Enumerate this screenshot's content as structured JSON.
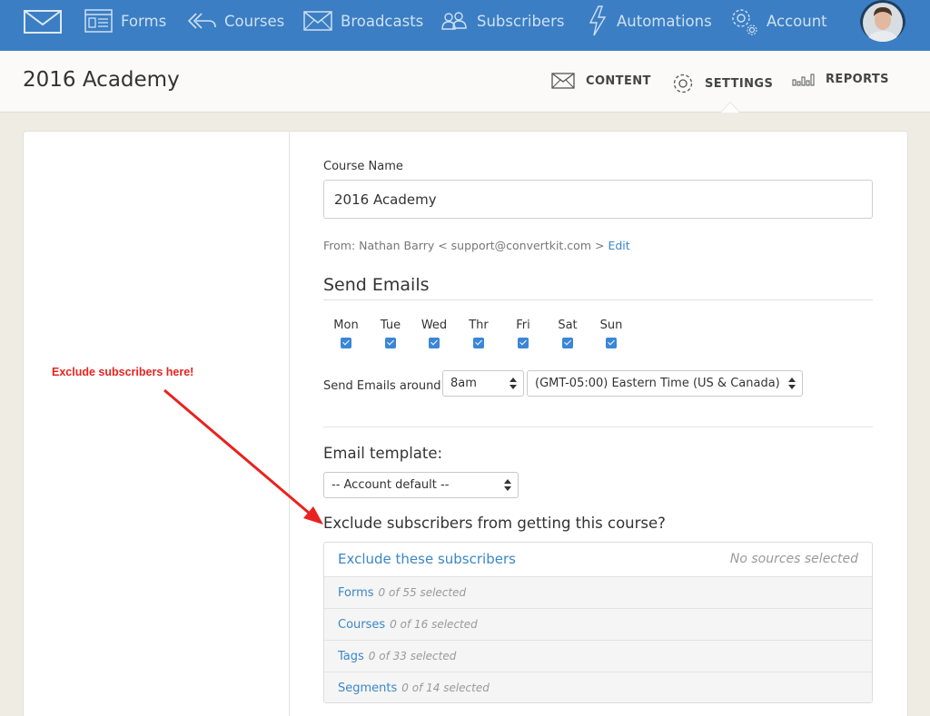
{
  "nav": {
    "items": [
      {
        "label": "Forms",
        "icon": "forms-icon"
      },
      {
        "label": "Courses",
        "icon": "courses-icon"
      },
      {
        "label": "Broadcasts",
        "icon": "broadcasts-icon"
      },
      {
        "label": "Subscribers",
        "icon": "subscribers-icon"
      },
      {
        "label": "Automations",
        "icon": "automations-icon"
      },
      {
        "label": "Account",
        "icon": "account-icon"
      }
    ]
  },
  "header": {
    "title": "2016 Academy",
    "tabs": [
      {
        "label": "CONTENT",
        "icon": "envelope-icon"
      },
      {
        "label": "SETTINGS",
        "icon": "gear-icon"
      },
      {
        "label": "REPORTS",
        "icon": "bar-chart-icon"
      }
    ]
  },
  "form": {
    "course_name_label": "Course Name",
    "course_name_value": "2016 Academy",
    "from_text": "From: Nathan Barry < support@convertkit.com >",
    "edit_link": "Edit",
    "send_emails_heading": "Send Emails",
    "days": [
      {
        "label": "Mon",
        "checked": true
      },
      {
        "label": "Tue",
        "checked": true
      },
      {
        "label": "Wed",
        "checked": true
      },
      {
        "label": "Thr",
        "checked": true
      },
      {
        "label": "Fri",
        "checked": true
      },
      {
        "label": "Sat",
        "checked": true
      },
      {
        "label": "Sun",
        "checked": true
      }
    ],
    "send_around_label": "Send Emails around",
    "time_value": "8am",
    "timezone_value": "(GMT-05:00) Eastern Time (US & Canada)",
    "template_heading": "Email template:",
    "template_value": "-- Account default --",
    "exclude_heading": "Exclude subscribers from getting this course?"
  },
  "exclude": {
    "title": "Exclude these subscribers",
    "status": "No sources selected",
    "rows": [
      {
        "label": "Forms",
        "count": "0 of 55 selected"
      },
      {
        "label": "Courses",
        "count": "0 of 16 selected"
      },
      {
        "label": "Tags",
        "count": "0 of 33 selected"
      },
      {
        "label": "Segments",
        "count": "0 of 14 selected"
      }
    ]
  },
  "annotation": {
    "text": "Exclude subscribers here!"
  },
  "colors": {
    "nav_bg": "#3b7ec3",
    "link": "#3a87c7",
    "annotation": "#e8231f"
  }
}
